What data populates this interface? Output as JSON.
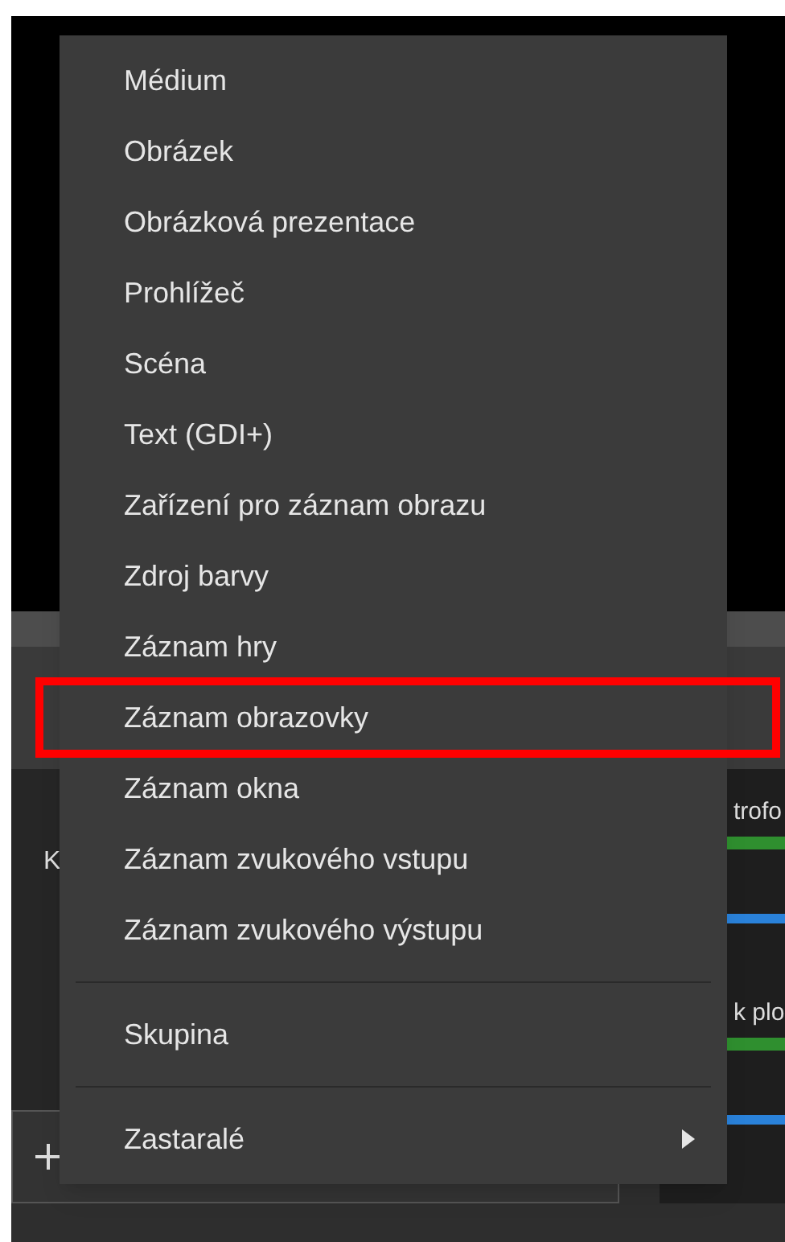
{
  "background": {
    "left_panel_label": "K",
    "mixer_channels": [
      {
        "name": "trofo",
        "level": 1
      },
      {
        "name": "k plo",
        "level": 1
      }
    ]
  },
  "context_menu": {
    "items": [
      {
        "kind": "item",
        "label": "Médium",
        "highlighted": false
      },
      {
        "kind": "item",
        "label": "Obrázek",
        "highlighted": false
      },
      {
        "kind": "item",
        "label": "Obrázková prezentace",
        "highlighted": false
      },
      {
        "kind": "item",
        "label": "Prohlížeč",
        "highlighted": false
      },
      {
        "kind": "item",
        "label": "Scéna",
        "highlighted": false
      },
      {
        "kind": "item",
        "label": "Text (GDI+)",
        "highlighted": false
      },
      {
        "kind": "item",
        "label": "Zařízení pro záznam obrazu",
        "highlighted": false
      },
      {
        "kind": "item",
        "label": "Zdroj barvy",
        "highlighted": false
      },
      {
        "kind": "item",
        "label": "Záznam hry",
        "highlighted": false
      },
      {
        "kind": "item",
        "label": "Záznam obrazovky",
        "highlighted": true
      },
      {
        "kind": "item",
        "label": "Záznam okna",
        "highlighted": false
      },
      {
        "kind": "item",
        "label": "Záznam zvukového vstupu",
        "highlighted": false
      },
      {
        "kind": "item",
        "label": "Záznam zvukového výstupu",
        "highlighted": false
      },
      {
        "kind": "separator"
      },
      {
        "kind": "item",
        "label": "Skupina",
        "highlighted": false
      },
      {
        "kind": "separator"
      },
      {
        "kind": "submenu",
        "label": "Zastaralé",
        "highlighted": false
      }
    ]
  }
}
